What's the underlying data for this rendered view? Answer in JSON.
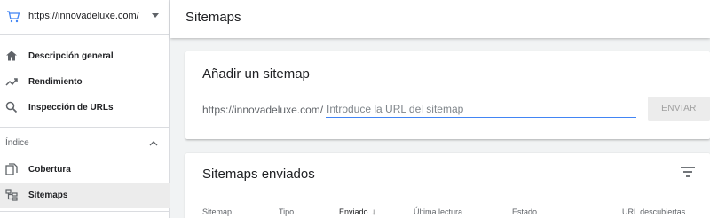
{
  "property": {
    "url": "https://innovadeluxe.com/"
  },
  "sidebar": {
    "items": [
      {
        "label": "Descripción general",
        "icon": "home-icon"
      },
      {
        "label": "Rendimiento",
        "icon": "trending-up-icon"
      },
      {
        "label": "Inspección de URLs",
        "icon": "search-icon"
      }
    ],
    "section": {
      "label": "Índice",
      "expanded": true
    },
    "index_items": [
      {
        "label": "Cobertura",
        "icon": "file-copy-icon"
      },
      {
        "label": "Sitemaps",
        "icon": "sitemap-icon",
        "active": true
      }
    ]
  },
  "header": {
    "title": "Sitemaps"
  },
  "add_sitemap": {
    "title": "Añadir un sitemap",
    "prefix": "https://innovadeluxe.com/",
    "placeholder": "Introduce la URL del sitemap",
    "submit_label": "ENVIAR"
  },
  "submitted": {
    "title": "Sitemaps enviados",
    "columns": [
      "Sitemap",
      "Tipo",
      "Enviado",
      "Última lectura",
      "Estado",
      "URL descubiertas"
    ],
    "sorted_column": "Enviado",
    "sort_direction": "descending"
  },
  "colors": {
    "accent": "#4285f4",
    "active_bg": "#ececec",
    "background": "#f1f3f4"
  }
}
